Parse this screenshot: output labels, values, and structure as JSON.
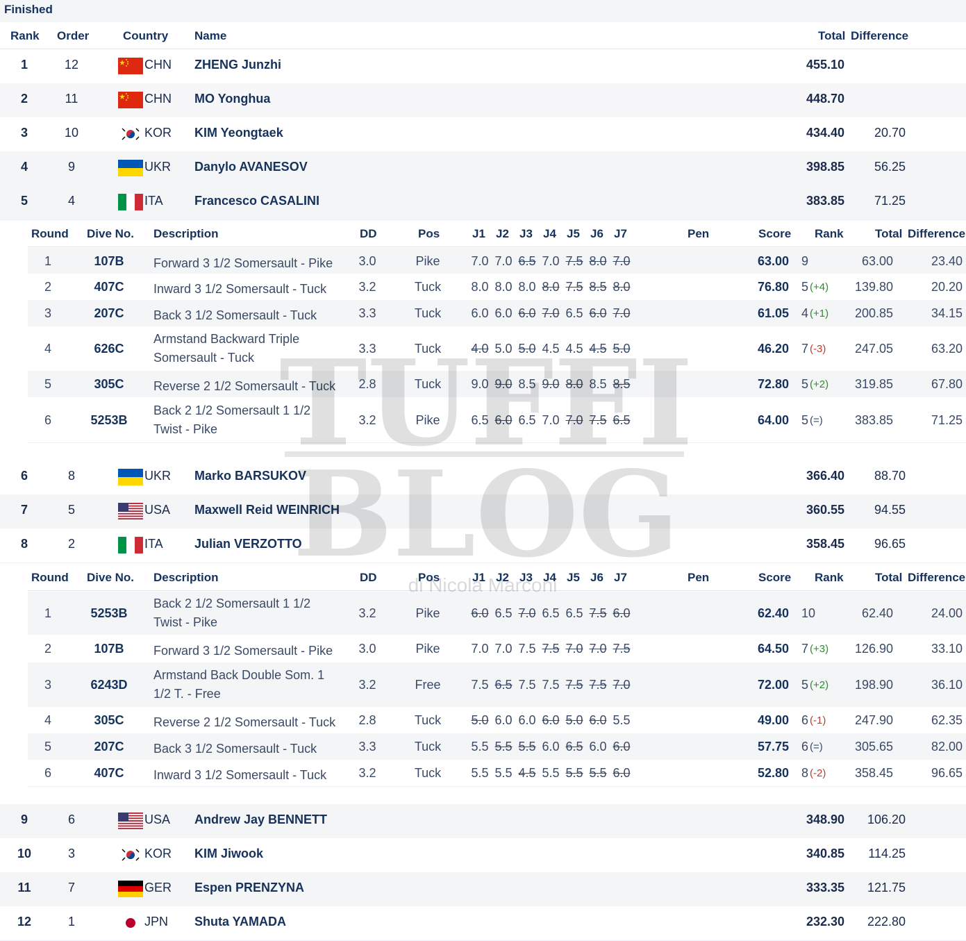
{
  "status_label": "Finished",
  "columns": {
    "rank": "Rank",
    "order": "Order",
    "country": "Country",
    "name": "Name",
    "total": "Total",
    "difference": "Difference"
  },
  "detail_columns": {
    "round": "Round",
    "dive_no": "Dive No.",
    "description": "Description",
    "dd": "DD",
    "pos": "Pos",
    "j1": "J1",
    "j2": "J2",
    "j3": "J3",
    "j4": "J4",
    "j5": "J5",
    "j6": "J6",
    "j7": "J7",
    "pen": "Pen",
    "score": "Score",
    "rank": "Rank",
    "total": "Total",
    "difference": "Difference"
  },
  "watermark": {
    "line1": "TUFFI",
    "line2": "BLOG",
    "sub": "di Nicola Marconi"
  },
  "athletes": [
    {
      "rank": "1",
      "order": "12",
      "country": "CHN",
      "name": "ZHENG Junzhi",
      "total": "455.10",
      "difference": ""
    },
    {
      "rank": "2",
      "order": "11",
      "country": "CHN",
      "name": "MO Yonghua",
      "total": "448.70",
      "difference": ""
    },
    {
      "rank": "3",
      "order": "10",
      "country": "KOR",
      "name": "KIM Yeongtaek",
      "total": "434.40",
      "difference": "20.70"
    },
    {
      "rank": "4",
      "order": "9",
      "country": "UKR",
      "name": "Danylo AVANESOV",
      "total": "398.85",
      "difference": "56.25"
    },
    {
      "rank": "5",
      "order": "4",
      "country": "ITA",
      "name": "Francesco CASALINI",
      "total": "383.85",
      "difference": "71.25"
    },
    {
      "rank": "6",
      "order": "8",
      "country": "UKR",
      "name": "Marko BARSUKOV",
      "total": "366.40",
      "difference": "88.70"
    },
    {
      "rank": "7",
      "order": "5",
      "country": "USA",
      "name": "Maxwell Reid WEINRICH",
      "total": "360.55",
      "difference": "94.55"
    },
    {
      "rank": "8",
      "order": "2",
      "country": "ITA",
      "name": "Julian VERZOTTO",
      "total": "358.45",
      "difference": "96.65"
    },
    {
      "rank": "9",
      "order": "6",
      "country": "USA",
      "name": "Andrew Jay BENNETT",
      "total": "348.90",
      "difference": "106.20"
    },
    {
      "rank": "10",
      "order": "3",
      "country": "KOR",
      "name": "KIM Jiwook",
      "total": "340.85",
      "difference": "114.25"
    },
    {
      "rank": "11",
      "order": "7",
      "country": "GER",
      "name": "Espen PRENZYNA",
      "total": "333.35",
      "difference": "121.75"
    },
    {
      "rank": "12",
      "order": "1",
      "country": "JPN",
      "name": "Shuta YAMADA",
      "total": "232.30",
      "difference": "222.80"
    }
  ],
  "details": {
    "casalini": [
      {
        "round": "1",
        "dive": "107B",
        "desc": "Forward 3 1/2 Somersault - Pike",
        "dd": "3.0",
        "pos": "Pike",
        "j": [
          "7.0",
          "7.0",
          "6.5",
          "7.0",
          "7.5",
          "8.0",
          "7.0"
        ],
        "x": [
          false,
          false,
          true,
          false,
          true,
          true,
          true
        ],
        "score": "63.00",
        "rank": "9",
        "chg": "",
        "chg_type": "",
        "total": "63.00",
        "diff": "23.40"
      },
      {
        "round": "2",
        "dive": "407C",
        "desc": "Inward 3 1/2 Somersault - Tuck",
        "dd": "3.2",
        "pos": "Tuck",
        "j": [
          "8.0",
          "8.0",
          "8.0",
          "8.0",
          "7.5",
          "8.5",
          "8.0"
        ],
        "x": [
          false,
          false,
          false,
          true,
          true,
          true,
          true
        ],
        "score": "76.80",
        "rank": "5",
        "chg": "(+4)",
        "chg_type": "up",
        "total": "139.80",
        "diff": "20.20"
      },
      {
        "round": "3",
        "dive": "207C",
        "desc": "Back 3 1/2 Somersault - Tuck",
        "dd": "3.3",
        "pos": "Tuck",
        "j": [
          "6.0",
          "6.0",
          "6.0",
          "7.0",
          "6.5",
          "6.0",
          "7.0"
        ],
        "x": [
          false,
          false,
          true,
          true,
          false,
          true,
          true
        ],
        "score": "61.05",
        "rank": "4",
        "chg": "(+1)",
        "chg_type": "up",
        "total": "200.85",
        "diff": "34.15"
      },
      {
        "round": "4",
        "dive": "626C",
        "desc": "Armstand Backward Triple Somersault - Tuck",
        "dd": "3.3",
        "pos": "Tuck",
        "j": [
          "4.0",
          "5.0",
          "5.0",
          "4.5",
          "4.5",
          "4.5",
          "5.0"
        ],
        "x": [
          true,
          false,
          true,
          false,
          false,
          true,
          true
        ],
        "score": "46.20",
        "rank": "7",
        "chg": "(-3)",
        "chg_type": "dn",
        "total": "247.05",
        "diff": "63.20"
      },
      {
        "round": "5",
        "dive": "305C",
        "desc": "Reverse 2 1/2 Somersault - Tuck",
        "dd": "2.8",
        "pos": "Tuck",
        "j": [
          "9.0",
          "9.0",
          "8.5",
          "9.0",
          "8.0",
          "8.5",
          "8.5"
        ],
        "x": [
          false,
          true,
          false,
          true,
          true,
          false,
          true
        ],
        "score": "72.80",
        "rank": "5",
        "chg": "(+2)",
        "chg_type": "up",
        "total": "319.85",
        "diff": "67.80"
      },
      {
        "round": "6",
        "dive": "5253B",
        "desc": "Back 2 1/2 Somersault 1 1/2 Twist - Pike",
        "dd": "3.2",
        "pos": "Pike",
        "j": [
          "6.5",
          "6.0",
          "6.5",
          "7.0",
          "7.0",
          "7.5",
          "6.5"
        ],
        "x": [
          false,
          true,
          false,
          false,
          true,
          true,
          true
        ],
        "score": "64.00",
        "rank": "5",
        "chg": "(=)",
        "chg_type": "eq",
        "total": "383.85",
        "diff": "71.25"
      }
    ],
    "verzotto": [
      {
        "round": "1",
        "dive": "5253B",
        "desc": "Back 2 1/2 Somersault 1 1/2 Twist - Pike",
        "dd": "3.2",
        "pos": "Pike",
        "j": [
          "6.0",
          "6.5",
          "7.0",
          "6.5",
          "6.5",
          "7.5",
          "6.0"
        ],
        "x": [
          true,
          false,
          true,
          false,
          false,
          true,
          true
        ],
        "score": "62.40",
        "rank": "10",
        "chg": "",
        "chg_type": "",
        "total": "62.40",
        "diff": "24.00"
      },
      {
        "round": "2",
        "dive": "107B",
        "desc": "Forward 3 1/2 Somersault - Pike",
        "dd": "3.0",
        "pos": "Pike",
        "j": [
          "7.0",
          "7.0",
          "7.5",
          "7.5",
          "7.0",
          "7.0",
          "7.5"
        ],
        "x": [
          false,
          false,
          false,
          true,
          true,
          true,
          true
        ],
        "score": "64.50",
        "rank": "7",
        "chg": "(+3)",
        "chg_type": "up",
        "total": "126.90",
        "diff": "33.10"
      },
      {
        "round": "3",
        "dive": "6243D",
        "desc": "Armstand Back Double Som. 1 1/2 T. - Free",
        "dd": "3.2",
        "pos": "Free",
        "j": [
          "7.5",
          "6.5",
          "7.5",
          "7.5",
          "7.5",
          "7.5",
          "7.0"
        ],
        "x": [
          false,
          true,
          false,
          false,
          true,
          true,
          true
        ],
        "score": "72.00",
        "rank": "5",
        "chg": "(+2)",
        "chg_type": "up",
        "total": "198.90",
        "diff": "36.10"
      },
      {
        "round": "4",
        "dive": "305C",
        "desc": "Reverse 2 1/2 Somersault - Tuck",
        "dd": "2.8",
        "pos": "Tuck",
        "j": [
          "5.0",
          "6.0",
          "6.0",
          "6.0",
          "5.0",
          "6.0",
          "5.5"
        ],
        "x": [
          true,
          false,
          false,
          true,
          true,
          true,
          false
        ],
        "score": "49.00",
        "rank": "6",
        "chg": "(-1)",
        "chg_type": "dn",
        "total": "247.90",
        "diff": "62.35"
      },
      {
        "round": "5",
        "dive": "207C",
        "desc": "Back 3 1/2 Somersault - Tuck",
        "dd": "3.3",
        "pos": "Tuck",
        "j": [
          "5.5",
          "5.5",
          "5.5",
          "6.0",
          "6.5",
          "6.0",
          "6.0"
        ],
        "x": [
          false,
          true,
          true,
          false,
          true,
          false,
          true
        ],
        "score": "57.75",
        "rank": "6",
        "chg": "(=)",
        "chg_type": "eq",
        "total": "305.65",
        "diff": "82.00"
      },
      {
        "round": "6",
        "dive": "407C",
        "desc": "Inward 3 1/2 Somersault - Tuck",
        "dd": "3.2",
        "pos": "Tuck",
        "j": [
          "5.5",
          "5.5",
          "4.5",
          "5.5",
          "5.5",
          "5.5",
          "6.0"
        ],
        "x": [
          false,
          false,
          true,
          false,
          true,
          true,
          true
        ],
        "score": "52.80",
        "rank": "8",
        "chg": "(-2)",
        "chg_type": "dn",
        "total": "358.45",
        "diff": "96.65"
      }
    ]
  }
}
